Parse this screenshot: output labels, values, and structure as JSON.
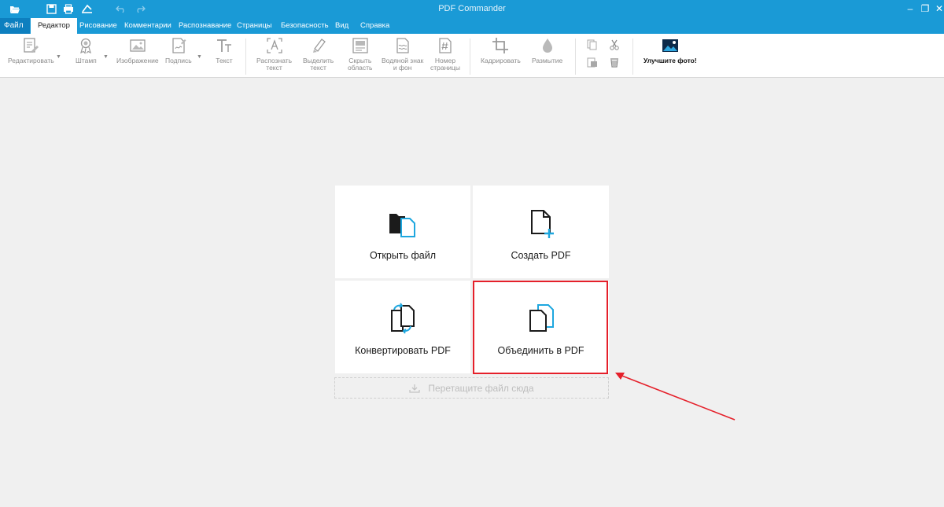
{
  "window": {
    "title": "PDF Commander",
    "controls": [
      "–",
      "❐",
      "✕"
    ]
  },
  "quick_access": [
    "folder-open-icon",
    "save-icon",
    "print-icon",
    "share-icon",
    "undo-icon",
    "redo-icon"
  ],
  "menu": {
    "file_label": "Файл",
    "tabs": [
      "Редактор",
      "Рисование",
      "Комментарии",
      "Распознавание",
      "Страницы",
      "Безопасность",
      "Вид",
      "Справка"
    ],
    "active_tab": "Редактор"
  },
  "ribbon": {
    "edit": "Редактировать",
    "stamp": "Штамп",
    "image": "Изображение",
    "signature": "Подпись",
    "text": "Текст",
    "recognize_1": "Распознать",
    "recognize_2": "текст",
    "highlight_1": "Выделить",
    "highlight_2": "текст",
    "hide_1": "Скрыть",
    "hide_2": "область",
    "watermark_1": "Водяной знак",
    "watermark_2": "и фон",
    "pagenum_1": "Номер",
    "pagenum_2": "страницы",
    "crop": "Кадрировать",
    "blur": "Размытие",
    "enhance": "Улучшите фото!"
  },
  "start": {
    "open_file": "Открыть файл",
    "create_pdf": "Создать PDF",
    "convert_pdf": "Конвертировать PDF",
    "merge_pdf": "Объединить в PDF",
    "drop_zone": "Перетащите файл сюда"
  },
  "colors": {
    "brand": "#1a9ad6",
    "accent_blue": "#1ea7df",
    "annotation_red": "#e5202a"
  }
}
